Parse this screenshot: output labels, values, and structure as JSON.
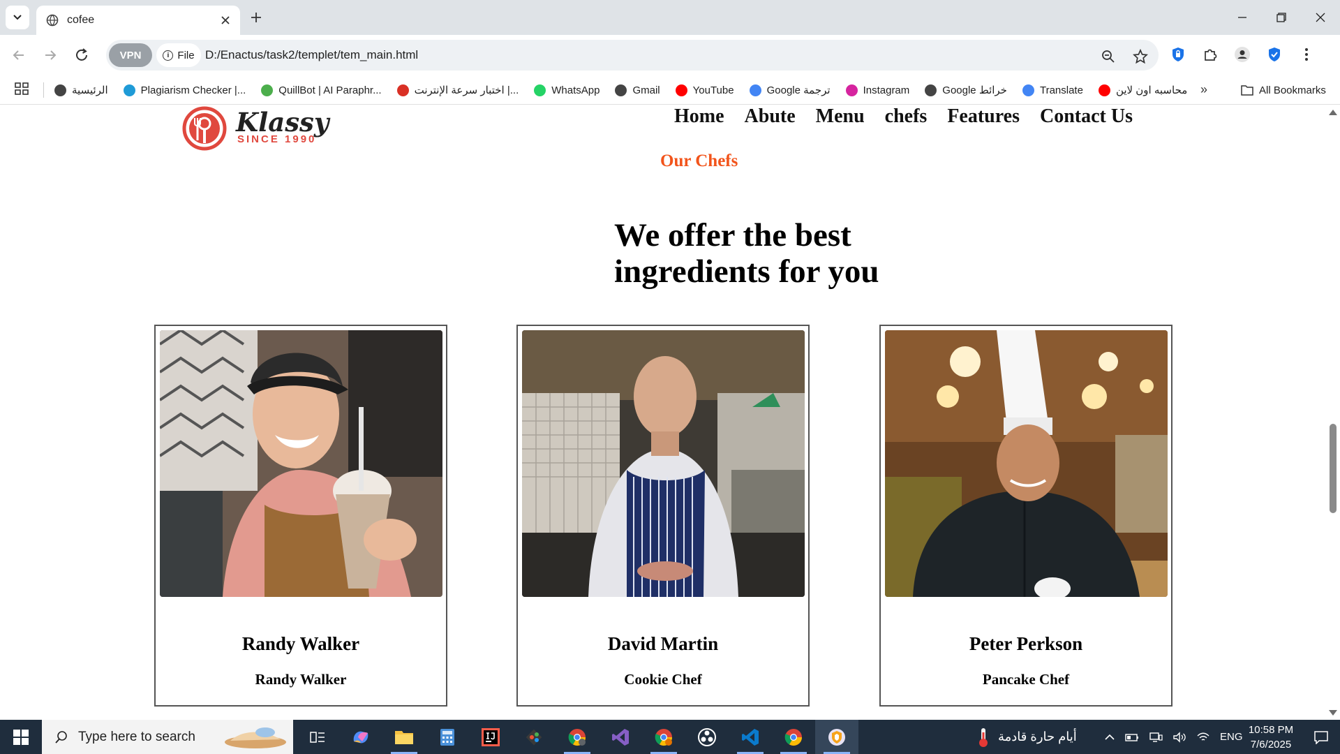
{
  "browser": {
    "tab_title": "cofee",
    "vpn_label": "VPN",
    "file_chip": "File",
    "url": "D:/Enactus/task2/templet/tem_main.html",
    "bookmarks": [
      {
        "label": "الرئيسية",
        "color": "#444444"
      },
      {
        "label": "Plagiarism Checker |...",
        "color": "#1f9bd7"
      },
      {
        "label": "QuillBot | AI Paraphr...",
        "color": "#4cae4c"
      },
      {
        "label": "اختبار سرعة الإنترنت |...",
        "color": "#d93025"
      },
      {
        "label": "WhatsApp",
        "color": "#25d366"
      },
      {
        "label": "Gmail",
        "color": "#444444"
      },
      {
        "label": "YouTube",
        "color": "#ff0000"
      },
      {
        "label": "Google ترجمة",
        "color": "#4285f4"
      },
      {
        "label": "Instagram",
        "color": "#d6249f"
      },
      {
        "label": "Google خرائط",
        "color": "#444444"
      },
      {
        "label": "Translate",
        "color": "#4285f4"
      },
      {
        "label": "محاسبه اون لاين",
        "color": "#ff0000"
      }
    ],
    "more_bookmarks": "»",
    "all_bookmarks": "All Bookmarks"
  },
  "site": {
    "logo_word": "Klassy",
    "logo_sub": "SINCE 1990",
    "nav": [
      "Home",
      "Abute",
      "Menu",
      "chefs",
      "Features",
      "Contact Us"
    ],
    "section_label": "Our Chefs",
    "headline": "We offer the best ingredients for you",
    "chefs": [
      {
        "name": "Randy Walker",
        "role": "Randy Walker"
      },
      {
        "name": "David Martin",
        "role": "Cookie Chef"
      },
      {
        "name": "Peter Perkson",
        "role": "Pancake Chef"
      }
    ]
  },
  "taskbar": {
    "search_placeholder": "Type here to search",
    "weather_text": "أيام حارة قادمة",
    "language": "ENG",
    "time": "10:58 PM",
    "date": "7/6/2025"
  }
}
